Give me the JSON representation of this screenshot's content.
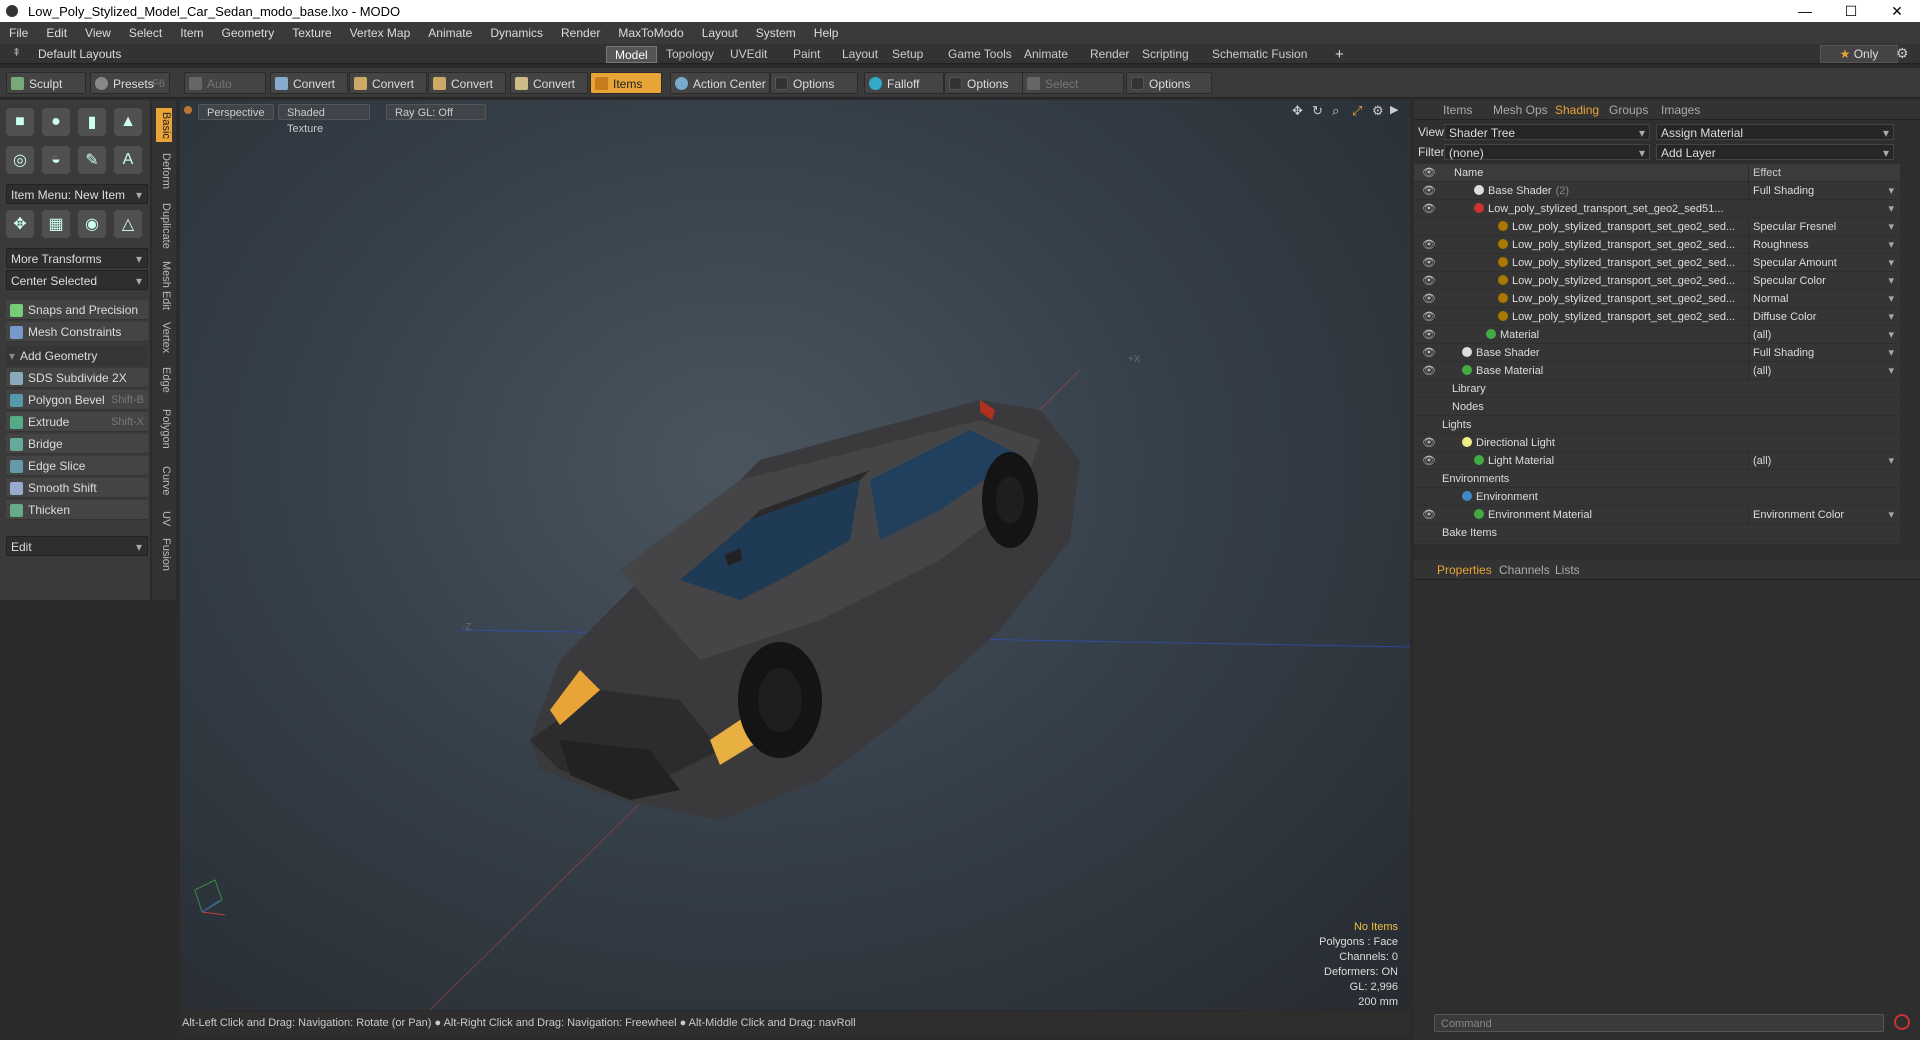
{
  "window": {
    "title": "Low_Poly_Stylized_Model_Car_Sedan_modo_base.lxo - MODO"
  },
  "menu": [
    "File",
    "Edit",
    "View",
    "Select",
    "Item",
    "Geometry",
    "Texture",
    "Vertex Map",
    "Animate",
    "Dynamics",
    "Render",
    "MaxToModo",
    "Layout",
    "System",
    "Help"
  ],
  "layout": {
    "default_layouts": "Default Layouts",
    "tabs": [
      "Model",
      "Topology",
      "UVEdit",
      "Paint",
      "Layout",
      "Setup",
      "Game Tools",
      "Animate",
      "Render",
      "Scripting",
      "Schematic Fusion"
    ],
    "only": "Only"
  },
  "toolbar": {
    "sculpt": "Sculpt",
    "presets": "Presets",
    "presets_key": "F6",
    "auto_select": "Auto Select",
    "convert": "Convert",
    "items": "Items",
    "action_center": "Action Center",
    "options": "Options",
    "falloff": "Falloff",
    "select_through": "Select Through"
  },
  "left": {
    "item_menu": "Item Menu: New Item",
    "more_transforms": "More Transforms",
    "center_selected": "Center Selected",
    "snaps": "Snaps and Precision",
    "mesh_constraints": "Mesh Constraints",
    "add_geometry": "Add Geometry",
    "tools": [
      {
        "label": "SDS Subdivide 2X",
        "key": ""
      },
      {
        "label": "Polygon Bevel",
        "key": "Shift-B"
      },
      {
        "label": "Extrude",
        "key": "Shift-X"
      },
      {
        "label": "Bridge",
        "key": ""
      },
      {
        "label": "Edge Slice",
        "key": ""
      },
      {
        "label": "Smooth Shift",
        "key": ""
      },
      {
        "label": "Thicken",
        "key": ""
      }
    ],
    "edit": "Edit"
  },
  "vtabs": [
    "Basic",
    "Deform",
    "Duplicate",
    "Mesh Edit",
    "Vertex",
    "Edge",
    "Polygon",
    "Curve",
    "UV",
    "Fusion"
  ],
  "viewport": {
    "perspective": "Perspective",
    "shaded": "Shaded Texture",
    "raygl": "Ray GL: Off",
    "stats": {
      "items": "No Items",
      "polygons": "Polygons : Face",
      "channels": "Channels: 0",
      "deformers": "Deformers: ON",
      "gl": "GL: 2,996",
      "size": "200 mm"
    }
  },
  "status": "Alt-Left Click and Drag: Navigation: Rotate (or Pan) ● Alt-Right Click and Drag: Navigation: Freewheel ● Alt-Middle Click and Drag: navRoll",
  "right": {
    "tabs": [
      "Items",
      "Mesh Ops",
      "Shading",
      "Groups",
      "Images"
    ],
    "view_label": "View",
    "view_value": "Shader Tree",
    "assign_material": "Assign Material",
    "filter_label": "Filter",
    "filter_value": "(none)",
    "add_layer": "Add Layer",
    "col_name": "Name",
    "col_effect": "Effect",
    "rows": [
      {
        "name": "Base Shader",
        "suffix": "(2)",
        "effect": "Full Shading",
        "eye": true,
        "indent": 60,
        "color": "#ddd"
      },
      {
        "name": "Low_poly_stylized_transport_set_geo2_sed51...",
        "suffix": "",
        "effect": "",
        "eye": true,
        "indent": 60,
        "color": "#c33"
      },
      {
        "name": "Low_poly_stylized_transport_set_geo2_sed...",
        "suffix": "",
        "effect": "Specular Fresnel",
        "eye": false,
        "indent": 84,
        "color": "#a70"
      },
      {
        "name": "Low_poly_stylized_transport_set_geo2_sed...",
        "suffix": "",
        "effect": "Roughness",
        "eye": true,
        "indent": 84,
        "color": "#a70"
      },
      {
        "name": "Low_poly_stylized_transport_set_geo2_sed...",
        "suffix": "",
        "effect": "Specular Amount",
        "eye": true,
        "indent": 84,
        "color": "#a70"
      },
      {
        "name": "Low_poly_stylized_transport_set_geo2_sed...",
        "suffix": "",
        "effect": "Specular Color",
        "eye": true,
        "indent": 84,
        "color": "#a70"
      },
      {
        "name": "Low_poly_stylized_transport_set_geo2_sed...",
        "suffix": "",
        "effect": "Normal",
        "eye": true,
        "indent": 84,
        "color": "#a70"
      },
      {
        "name": "Low_poly_stylized_transport_set_geo2_sed...",
        "suffix": "",
        "effect": "Diffuse Color",
        "eye": true,
        "indent": 84,
        "color": "#a70"
      },
      {
        "name": "Material",
        "suffix": "",
        "effect": "(all)",
        "eye": true,
        "indent": 72,
        "color": "#4a4"
      },
      {
        "name": "Base Shader",
        "suffix": "",
        "effect": "Full Shading",
        "eye": true,
        "indent": 48,
        "color": "#ddd"
      },
      {
        "name": "Base Material",
        "suffix": "",
        "effect": "(all)",
        "eye": true,
        "indent": 48,
        "color": "#4a4"
      },
      {
        "name": "Library",
        "suffix": "",
        "effect": "",
        "eye": false,
        "indent": 38,
        "color": ""
      },
      {
        "name": "Nodes",
        "suffix": "",
        "effect": "",
        "eye": false,
        "indent": 38,
        "color": ""
      },
      {
        "name": "Lights",
        "suffix": "",
        "effect": "",
        "eye": false,
        "indent": 28,
        "color": ""
      },
      {
        "name": "Directional Light",
        "suffix": "",
        "effect": "",
        "eye": true,
        "indent": 48,
        "color": "#ee8"
      },
      {
        "name": "Light Material",
        "suffix": "",
        "effect": "(all)",
        "eye": true,
        "indent": 60,
        "color": "#4a4"
      },
      {
        "name": "Environments",
        "suffix": "",
        "effect": "",
        "eye": false,
        "indent": 28,
        "color": ""
      },
      {
        "name": "Environment",
        "suffix": "",
        "effect": "",
        "eye": false,
        "indent": 48,
        "color": "#48c"
      },
      {
        "name": "Environment Material",
        "suffix": "",
        "effect": "Environment Color",
        "eye": true,
        "indent": 60,
        "color": "#4a4"
      },
      {
        "name": "Bake Items",
        "suffix": "",
        "effect": "",
        "eye": false,
        "indent": 28,
        "color": ""
      }
    ],
    "prop_tabs": [
      "Properties",
      "Channels",
      "Lists"
    ],
    "command": "Command"
  }
}
